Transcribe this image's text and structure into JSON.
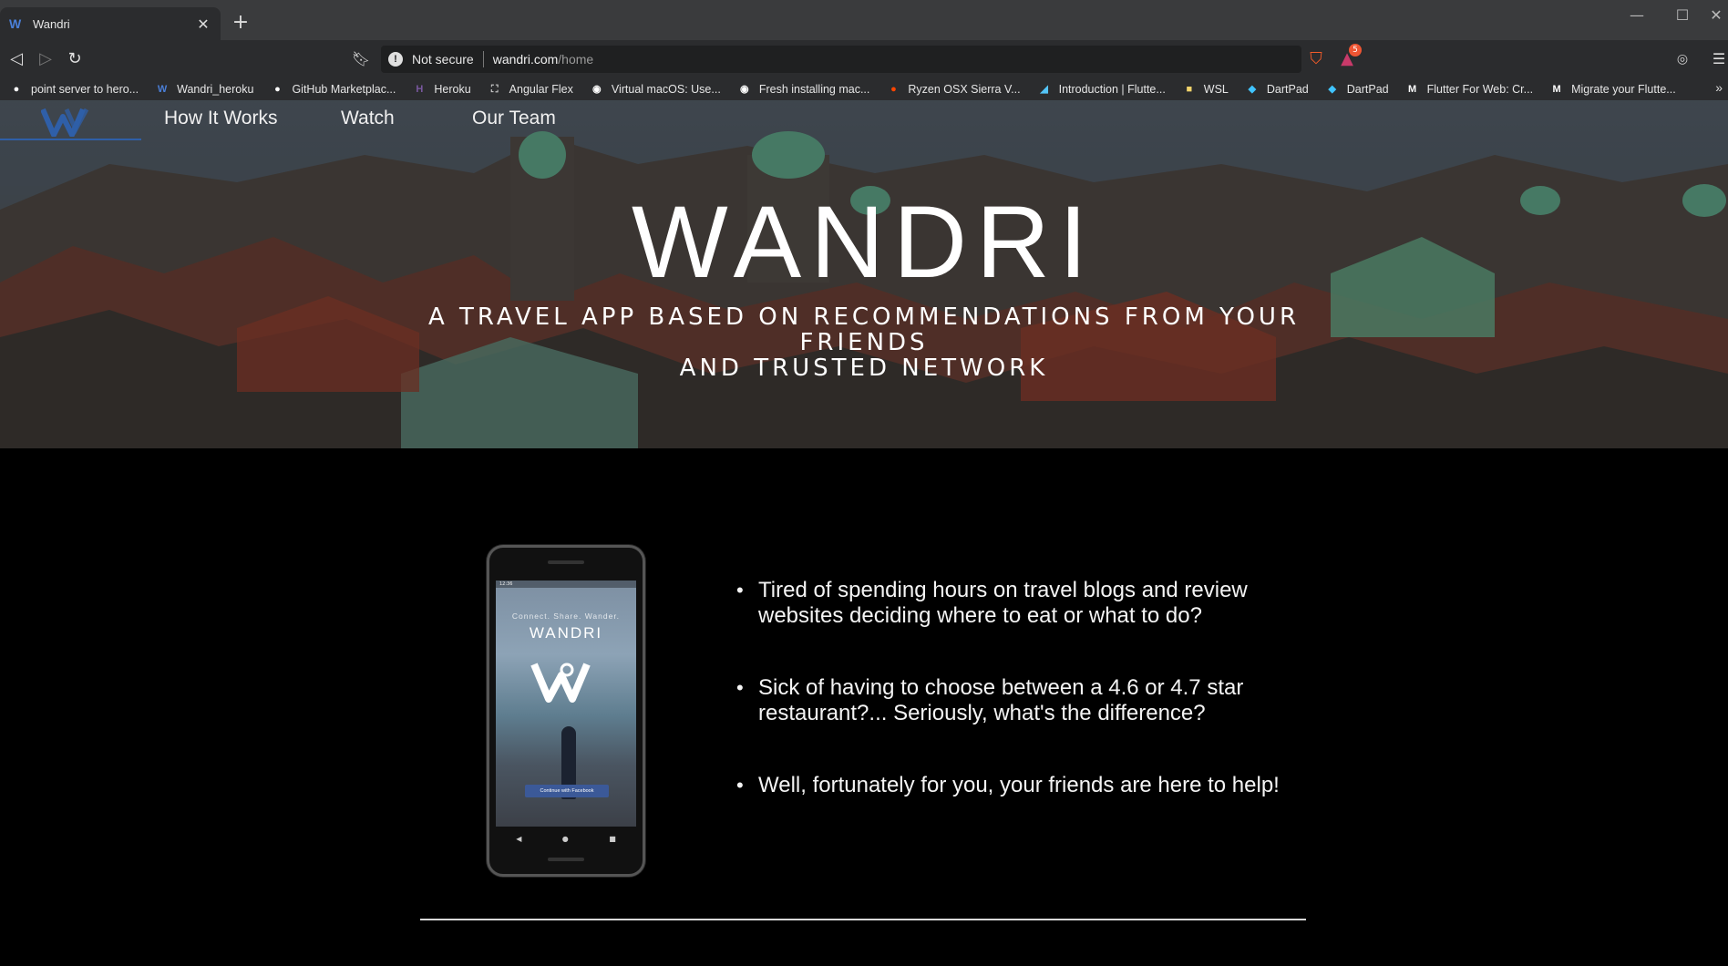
{
  "browser": {
    "tab_title": "Wandri",
    "tab_favicon": "W",
    "url_security": "Not secure",
    "url_host": "wandri.com",
    "url_path": "/home",
    "rewards_badge": "5",
    "bookmarks": [
      {
        "label": "point server to hero...",
        "icon": "github-icon",
        "glyph": "●",
        "color": "#ffffff"
      },
      {
        "label": "Wandri_heroku",
        "icon": "wandri-icon",
        "glyph": "W",
        "color": "#4a7fd8"
      },
      {
        "label": "GitHub Marketplac...",
        "icon": "github-icon",
        "glyph": "●",
        "color": "#ffffff"
      },
      {
        "label": "Heroku",
        "icon": "heroku-icon",
        "glyph": "H",
        "color": "#79589f"
      },
      {
        "label": "Angular Flex",
        "icon": "angular-flex-icon",
        "glyph": "⛶",
        "color": "#cccccc"
      },
      {
        "label": "Virtual macOS: Use...",
        "icon": "bookmark-icon",
        "glyph": "◉",
        "color": "#ffffff"
      },
      {
        "label": "Fresh installing mac...",
        "icon": "bookmark-icon",
        "glyph": "◉",
        "color": "#ffffff"
      },
      {
        "label": "Ryzen OSX Sierra V...",
        "icon": "reddit-icon",
        "glyph": "●",
        "color": "#ff4500"
      },
      {
        "label": "Introduction | Flutte...",
        "icon": "flutter-icon",
        "glyph": "◢",
        "color": "#54c5f8"
      },
      {
        "label": "WSL",
        "icon": "folder-icon",
        "glyph": "■",
        "color": "#f2d46b"
      },
      {
        "label": "DartPad",
        "icon": "dart-icon",
        "glyph": "◆",
        "color": "#40c4ff"
      },
      {
        "label": "DartPad",
        "icon": "dart-icon",
        "glyph": "◆",
        "color": "#40c4ff"
      },
      {
        "label": "Flutter For Web: Cr...",
        "icon": "medium-icon",
        "glyph": "M",
        "color": "#ffffff"
      },
      {
        "label": "Migrate your Flutte...",
        "icon": "medium-icon",
        "glyph": "M",
        "color": "#ffffff"
      }
    ]
  },
  "site": {
    "nav": [
      "How It Works",
      "Watch",
      "Our Team"
    ],
    "hero_title": "WANDRI",
    "hero_subtitle_line1": "A TRAVEL APP BASED ON RECOMMENDATIONS FROM YOUR FRIENDS",
    "hero_subtitle_line2": "AND TRUSTED NETWORK",
    "phone": {
      "tagline": "Connect. Share. Wander.",
      "brand": "WANDRI",
      "fb_button": "Continue with Facebook",
      "status_time": "12:36"
    },
    "points": [
      "Tired of spending hours on travel blogs and review websites deciding where to eat or what to do?",
      "Sick of having to choose between a 4.6 or 4.7 star restaurant?... Seriously, what's the difference?",
      "Well, fortunately for you, your friends are here to help!"
    ],
    "accent_color": "#2f5fa8"
  }
}
